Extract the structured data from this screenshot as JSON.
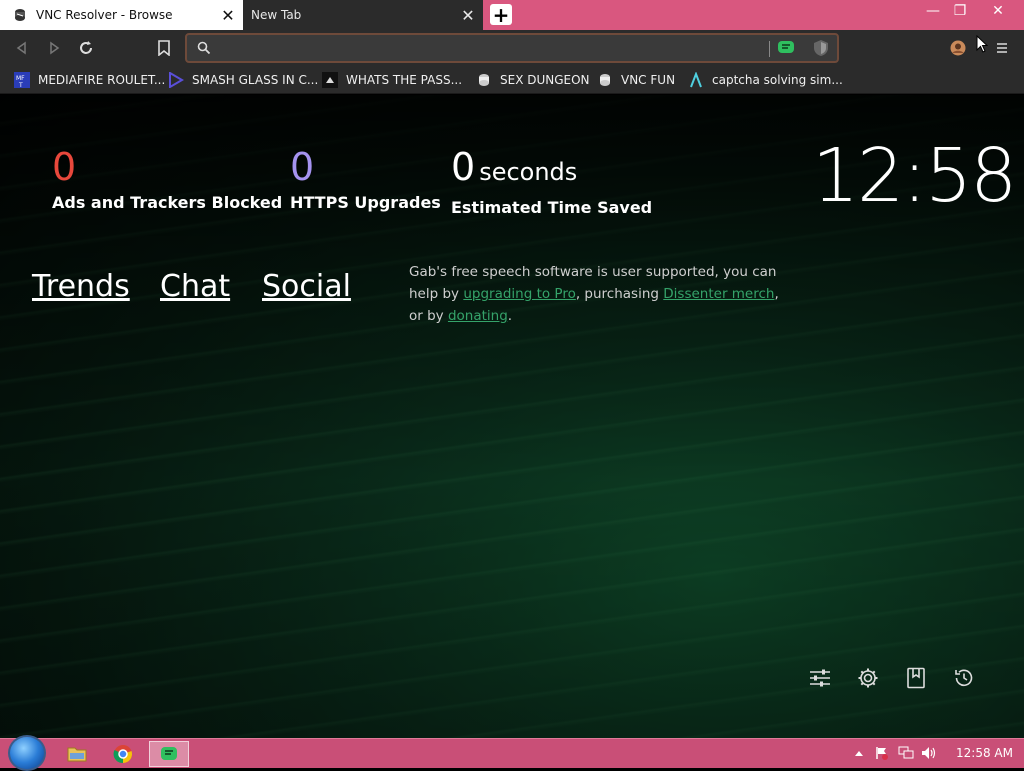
{
  "tabs": [
    {
      "title": "VNC Resolver - Browse",
      "icon": "vnc-icon",
      "close": "✕"
    },
    {
      "title": "New Tab",
      "close": "✕"
    }
  ],
  "new_tab_symbol": "+",
  "window_controls": {
    "minimize": "—",
    "maximize": "❐",
    "close": "✕"
  },
  "address_bar": {
    "value": "",
    "placeholder": ""
  },
  "bookmarks": [
    {
      "label": "MEDIAFIRE ROULET...",
      "icon": "mediafire-icon"
    },
    {
      "label": "SMASH GLASS IN C...",
      "icon": "triangle-icon"
    },
    {
      "label": "WHATS THE PASS...",
      "icon": "dark-square-icon"
    },
    {
      "label": "SEX DUNGEON",
      "icon": "vnc-icon"
    },
    {
      "label": "VNC FUN",
      "icon": "vnc-icon"
    },
    {
      "label": "captcha solving sim...",
      "icon": "lambda-icon"
    }
  ],
  "stats": {
    "ads": {
      "value": "0",
      "label": "Ads and Trackers Blocked",
      "color": "#e8483c"
    },
    "https": {
      "value": "0",
      "label": "HTTPS Upgrades",
      "color": "#a593f0"
    },
    "time": {
      "value": "0",
      "unit": "seconds",
      "label": "Estimated Time Saved",
      "color": "#ffffff"
    }
  },
  "clock": "12:58",
  "nav_links": [
    "Trends",
    "Chat",
    "Social"
  ],
  "support_note": {
    "part1": "Gab's free speech software is user supported, you can help by ",
    "link1": "upgrading to Pro",
    "part2": ", purchasing ",
    "link2": "Dissenter merch",
    "part3": ", or by ",
    "link3": "donating",
    "part4": "."
  },
  "bottom_icons": [
    "sliders-icon",
    "gear-icon",
    "bookmark-icon",
    "history-icon"
  ],
  "taskbar": {
    "apps": [
      "file-explorer-icon",
      "chrome-icon",
      "dissenter-icon"
    ],
    "time": "12:58 AM"
  },
  "colors": {
    "accent_pink": "#d9577f",
    "link_green": "#35a36a"
  }
}
